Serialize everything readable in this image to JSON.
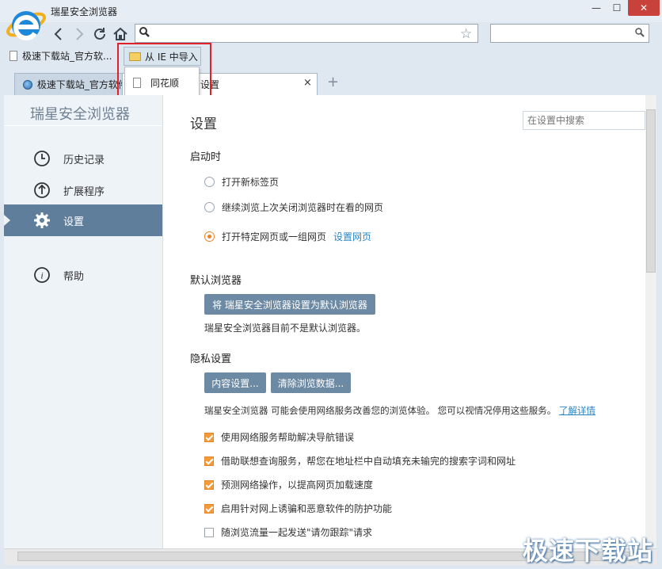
{
  "window": {
    "title": "瑞星安全浏览器",
    "close_symbol": "✕"
  },
  "nav": {
    "back": "back-icon",
    "forward": "forward-icon",
    "refresh": "refresh-icon",
    "home": "home-icon",
    "address_value": "",
    "search_value": ""
  },
  "bookmarks": {
    "item1": "极速下载站_官方软...",
    "folder": "从 IE 中导入",
    "dropdown_items": [
      "同花顺"
    ]
  },
  "tabs": [
    {
      "label": "极速下载站_官方软件",
      "active": false
    },
    {
      "label": "设置",
      "active": true,
      "close": "×"
    }
  ],
  "new_tab": "+",
  "sidebar": {
    "title": "瑞星安全浏览器",
    "items": [
      {
        "label": "历史记录",
        "icon": "history-icon"
      },
      {
        "label": "扩展程序",
        "icon": "extensions-icon"
      },
      {
        "label": "设置",
        "icon": "settings-icon",
        "active": true
      },
      {
        "label": "帮助",
        "icon": "help-icon"
      }
    ]
  },
  "main": {
    "title": "设置",
    "search_placeholder": "在设置中搜索",
    "startup": {
      "heading": "启动时",
      "options": [
        "打开新标签页",
        "继续浏览上次关闭浏览器时在看的网页",
        "打开特定网页或一组网页"
      ],
      "selected_index": 2,
      "set_pages_link": "设置网页"
    },
    "default_browser": {
      "heading": "默认浏览器",
      "button": "将 瑞星安全浏览器设置为默认浏览器",
      "status": "瑞星安全浏览器目前不是默认浏览器。"
    },
    "privacy": {
      "heading": "隐私设置",
      "content_button": "内容设置...",
      "clear_button": "清除浏览数据...",
      "description": "瑞星安全浏览器 可能会使用网络服务改善您的浏览体验。 您可以视情况停用这些服务。",
      "learn_more": "了解详情",
      "checkboxes": [
        {
          "label": "使用网络服务帮助解决导航错误",
          "checked": true
        },
        {
          "label": "借助联想查询服务，帮您在地址栏中自动填充未输完的搜索字词和网址",
          "checked": true
        },
        {
          "label": "预测网络操作，以提高网页加载速度",
          "checked": true
        },
        {
          "label": "启用针对网上诱骗和恶意软件的防护功能",
          "checked": true
        },
        {
          "label": "随浏览流量一起发送\"请勿跟踪\"请求",
          "checked": false
        }
      ]
    }
  },
  "watermark": "极速下载站",
  "colors": {
    "accent": "#e6862a",
    "sidebar_active": "#5e7e9b",
    "button": "#6d8aa4",
    "link": "#2a86c8",
    "highlight": "#e0212a"
  }
}
